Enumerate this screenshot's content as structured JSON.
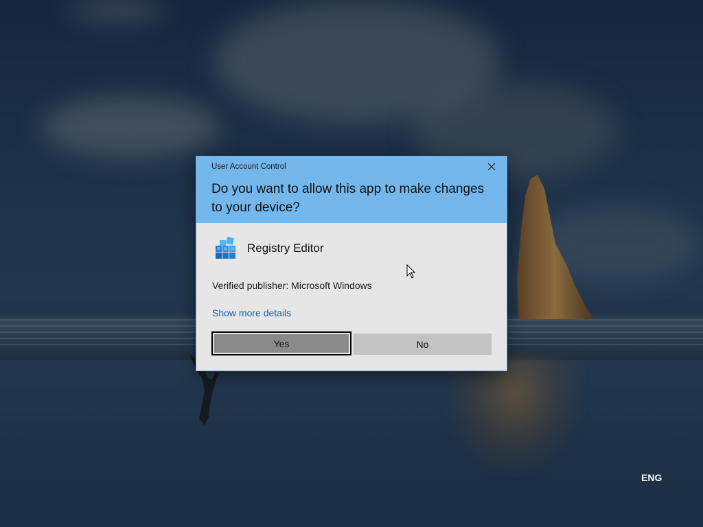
{
  "dialog": {
    "caption": "User Account Control",
    "question": "Do you want to allow this app to make changes to your device?",
    "app_name": "Registry Editor",
    "app_icon": "registry-editor-icon",
    "publisher": "Verified publisher: Microsoft Windows",
    "more_details_link": "Show more details",
    "yes_label": "Yes",
    "no_label": "No",
    "close_icon": "close-icon",
    "header_color": "#74b7ec",
    "link_color": "#0a64b4"
  },
  "taskbar": {
    "language": "ENG"
  }
}
